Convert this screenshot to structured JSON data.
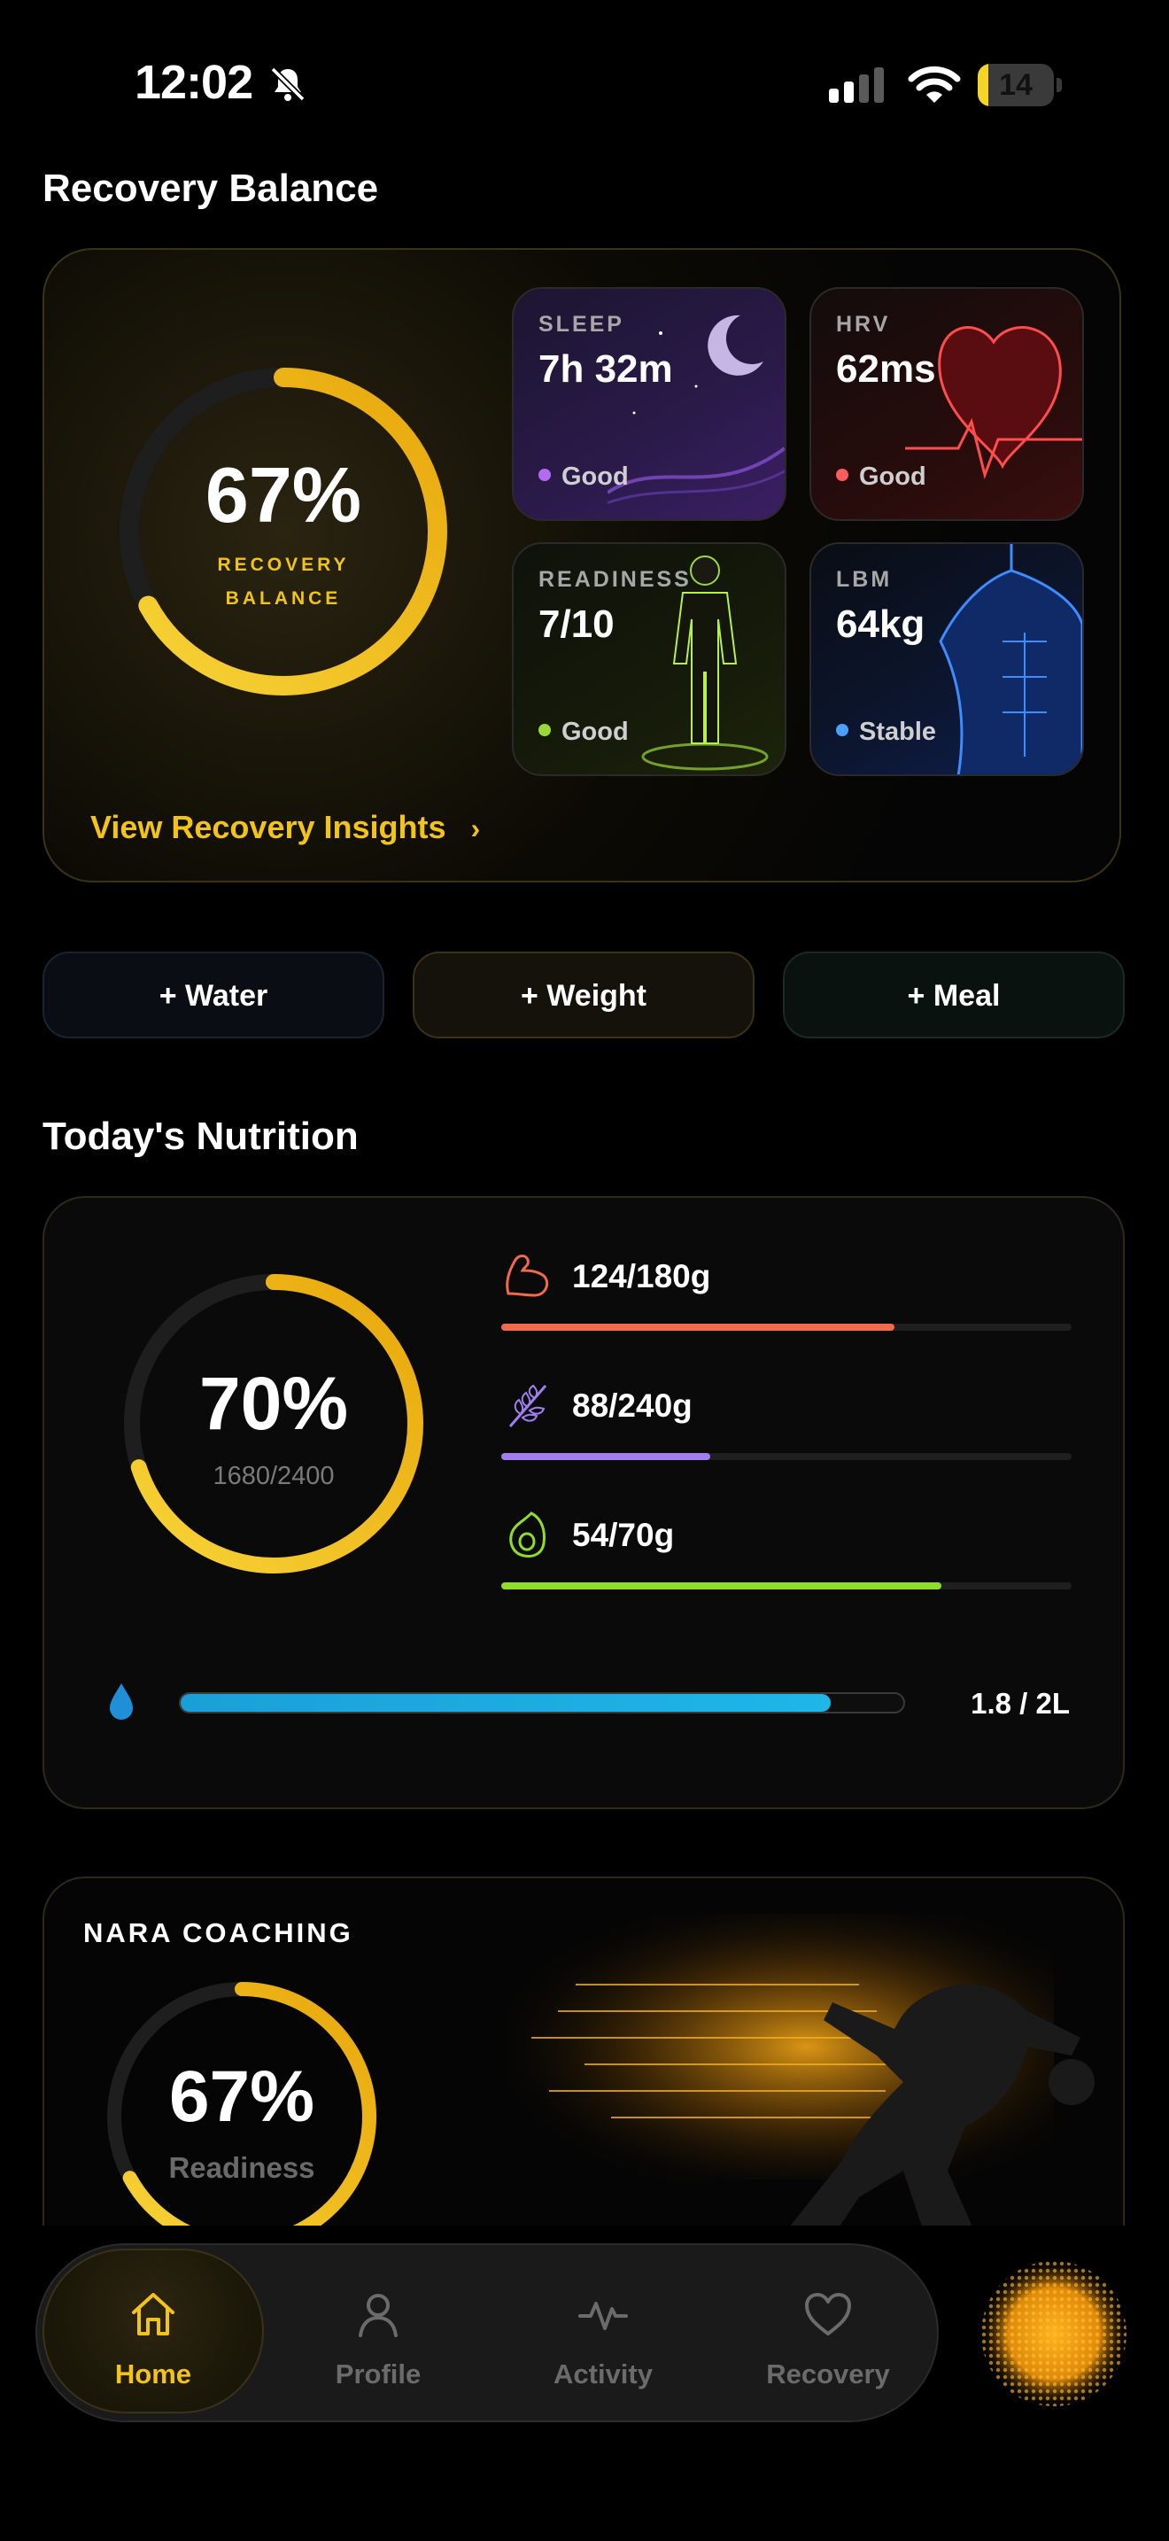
{
  "status_bar": {
    "time": "12:02",
    "battery": "14",
    "battery_level": 0.14
  },
  "recovery": {
    "section_title": "Recovery Balance",
    "ring": {
      "percent_text": "67%",
      "label_line1": "RECOVERY",
      "label_line2": "BALANCE",
      "value": 0.67
    },
    "tiles": [
      {
        "label": "SLEEP",
        "value": "7h 32m",
        "status": "Good",
        "dot_color": "#b36cf0",
        "art": "moon-icon"
      },
      {
        "label": "HRV",
        "value": "62ms",
        "status": "Good",
        "dot_color": "#ff5c5c",
        "art": "heart-icon"
      },
      {
        "label": "READINESS",
        "value": "7/10",
        "status": "Good",
        "dot_color": "#9ad83a",
        "art": "body-figure-icon"
      },
      {
        "label": "LBM",
        "value": "64kg",
        "status": "Stable",
        "dot_color": "#4aa0ff",
        "art": "torso-icon"
      }
    ],
    "insights_link": "View Recovery Insights"
  },
  "quick_actions": [
    "+ Water",
    "+ Weight",
    "+ Meal"
  ],
  "nutrition": {
    "section_title": "Today's Nutrition",
    "ring": {
      "percent_text": "70%",
      "sub_text": "1680/2400",
      "value": 0.7
    },
    "macros": [
      {
        "icon": "muscle-icon",
        "value": "124/180g",
        "fraction": 0.689,
        "color": "#f06a4c"
      },
      {
        "icon": "wheat-icon",
        "value": "88/240g",
        "fraction": 0.367,
        "color": "#a07ef0"
      },
      {
        "icon": "avocado-icon",
        "value": "54/70g",
        "fraction": 0.771,
        "color": "#8fdc2c"
      }
    ],
    "water": {
      "icon": "water-drop-icon",
      "value": "1.8 / 2L",
      "fraction": 0.9,
      "color": "#1fb0e0"
    }
  },
  "coaching": {
    "title": "NARA COACHING",
    "ring": {
      "percent_text": "67%",
      "sub_text": "Readiness",
      "value": 0.67
    }
  },
  "nav": {
    "items": [
      {
        "label": "Home",
        "icon": "home-icon",
        "active": true
      },
      {
        "label": "Profile",
        "icon": "profile-icon",
        "active": false
      },
      {
        "label": "Activity",
        "icon": "activity-icon",
        "active": false
      },
      {
        "label": "Recovery",
        "icon": "heart-outline-icon",
        "active": false
      }
    ],
    "assistant_orb": "assistant-orb-icon"
  },
  "colors": {
    "accent": "#f2c318",
    "background": "#000000"
  }
}
